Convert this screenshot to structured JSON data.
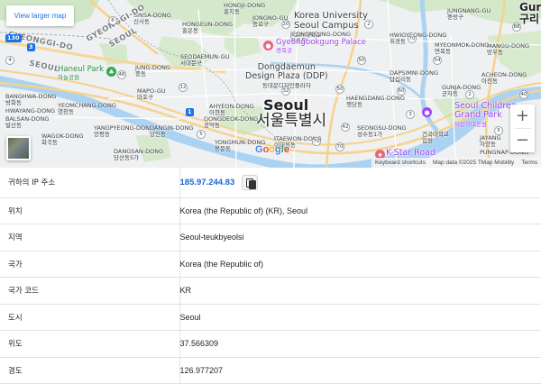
{
  "map": {
    "larger_link": "View larger map",
    "zoom_in": "+",
    "zoom_out": "−",
    "google": [
      "G",
      "o",
      "o",
      "g",
      "l",
      "e"
    ],
    "google_colors": [
      "#4285f4",
      "#ea4335",
      "#fbbc05",
      "#4285f4",
      "#34a853",
      "#ea4335"
    ],
    "attribution": {
      "shortcuts": "Keyboard shortcuts",
      "data": "Map data ©2025 TMap Mobility",
      "terms": "Terms"
    },
    "labels": {
      "seoul_en": "Seoul",
      "seoul_ko": "서울특별시",
      "hongji": "HONGJI-DONG",
      "hongji_ko": "홍지동",
      "sinsa": "SINSA-DONG",
      "sinsa_ko": "신사동",
      "jongno": "JONGNO-GU",
      "jongno_ko": "종로구",
      "korea_univ": "Korea University",
      "seoul_campus": "Seoul Campus",
      "korea_univ_ko": "고려대학교",
      "jungnang": "JUNGNANG-GU",
      "jungnang_ko": "중랑구",
      "guri_en": "Gur",
      "guri_ko": "구리",
      "gyeonggi_top": "GYEONGGI-DO",
      "gyeonggi_left": "GYEONGGI-DO",
      "seoul_road_top": "SEOUL",
      "seoul_road_left": "SEOUL",
      "hongeun": "HONGEUN-DONG",
      "hongeun_ko": "홍은동",
      "jeongneung": "JEONGNEUNG-DONG",
      "jeongneung_ko": "정릉동",
      "gyeongbok": "Gyeongbokgung Palace",
      "gyeongbok_ko": "경복궁",
      "hwigyeong": "HWIGYEONG-DONG",
      "hwigyeong_ko": "휘경동",
      "myeonmok": "MYEONMOK-DONG",
      "myeonmok_ko": "면목동",
      "mangu": "MANGU-DONG",
      "mangu_ko": "망우동",
      "seodaemun": "SEODAEMUN-GU",
      "seodaemun_ko": "서대문구",
      "haneul": "Haneul Park",
      "haneul_ko": "하늘공원",
      "jung": "JUNG-DONG",
      "jung_ko": "중동",
      "ddp1": "Dongdaemun",
      "ddp2": "Design Plaza (DDP)",
      "ddp_ko": "동대문디자인플라자",
      "dapsimni": "DAPSIMNI-DONG",
      "dapsimni_ko": "답십리동",
      "achoen": "ACHEON-DONG",
      "achoen_ko": "아천동",
      "mapo": "MAPO-GU",
      "mapo_ko": "마포구",
      "gunja": "GUNJA-DONG",
      "gunja_ko": "군자동",
      "haengdang": "HAENGDANG-DONG",
      "haengdang_ko": "행당동",
      "banghwa": "BANGHWA-DONG",
      "banghwa_ko": "방화동",
      "yeomchang": "YEOMCHANG-DONG",
      "yeomchang_ko": "염창동",
      "ahyeon": "AHYEON-DONG",
      "ahyeon_ko": "아현동",
      "gongdeok": "GONGDEOK-DONG",
      "gongdeok_ko": "공덕동",
      "seoul_children": "Seoul Children",
      "grand_park": "Grand Park",
      "grand_park_ko": "어린이대공원",
      "hwayang": "HWAYANG-DONG",
      "gwangjang": "GWANGJANG",
      "balsan": "BALSAN-DONG",
      "balsan_ko": "발산동",
      "wagok": "WAGOK-DONG",
      "wagok_ko": "화곡동",
      "yangpyeong": "YANGPYEONG-DONG",
      "yangpyeong_ko": "양평동",
      "yongsan": "YONGSAN-DONG",
      "yongsan_ko": "용산동",
      "dangin": "DANGIN-DONG",
      "dangin_ko": "당인동",
      "yongmun": "YONGMUN-DONG",
      "yongmun_ko": "용문동",
      "itaewon": "ITAEWON-DONG",
      "itaewon_ko": "이태원동",
      "seongsu": "SEONGSU-DONG",
      "seongsu_ko": "성수동1가",
      "sogang": "SOGANG-GU",
      "sogang_ko": "서강구",
      "jayang": "JAYANG",
      "jayang_ko": "자양동",
      "pungnap": "PUNGNAP-DONG",
      "konkuk": "건국대학교",
      "konkuk2": "입원",
      "kstar": "K-Star Road",
      "dangsan": "DANGSAN-DONG",
      "dangsan_ko": "당산동5가",
      "jung_gu": "JUNG-GU",
      "jung_gu_ko": "중구"
    },
    "shields": [
      "130",
      "3",
      "4",
      "6",
      "46",
      "12",
      "20",
      "2",
      "88",
      "70",
      "50",
      "54",
      "50",
      "60",
      "1",
      "32",
      "5",
      "3",
      "42",
      "70",
      "5",
      "40",
      "2",
      "70"
    ]
  },
  "info": {
    "ip": {
      "label": "귀하의 IP 주소",
      "value": "185.97.244.83"
    },
    "rows": [
      {
        "label": "위치",
        "value": "Korea (the Republic of) (KR), Seoul"
      },
      {
        "label": "지역",
        "value": "Seoul-teukbyeolsi"
      },
      {
        "label": "국가",
        "value": "Korea (the Republic of)"
      },
      {
        "label": "국가 코드",
        "value": "KR"
      },
      {
        "label": "도시",
        "value": "Seoul"
      },
      {
        "label": "위도",
        "value": "37.566309"
      },
      {
        "label": "경도",
        "value": "126.977207"
      }
    ]
  }
}
